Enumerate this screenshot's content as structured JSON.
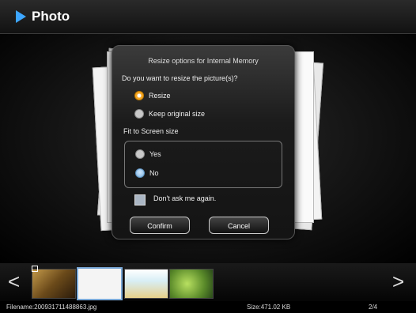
{
  "header": {
    "title": "Photo"
  },
  "dialog": {
    "title": "Resize options for Internal Memory",
    "question": "Do you want to resize the picture(s)?",
    "resize_options": [
      {
        "label": "Resize",
        "selected": true
      },
      {
        "label": "Keep original size",
        "selected": false
      }
    ],
    "fit_label": "Fit to Screen size",
    "fit_options": [
      {
        "label": "Yes",
        "selected": false
      },
      {
        "label": "No",
        "selected": true
      }
    ],
    "checkbox_label": "Don't ask me again.",
    "confirm_label": "Confirm",
    "cancel_label": "Cancel"
  },
  "nav": {
    "left": "<",
    "right": ">"
  },
  "footer": {
    "filename": "Filename:200931711488863.jpg",
    "size": "Size:471.02 KB",
    "position": "2/4"
  },
  "colors": {
    "accent": "#3da6ff",
    "selected_radio": "#f5a623",
    "thumb_highlight": "#7aa9d8"
  }
}
